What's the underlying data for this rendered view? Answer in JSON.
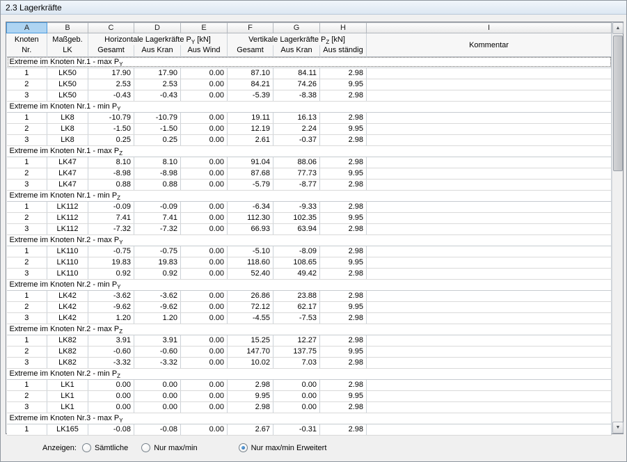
{
  "window": {
    "title": "2.3 Lagerkräfte"
  },
  "table": {
    "column_letters": [
      "A",
      "B",
      "C",
      "D",
      "E",
      "F",
      "G",
      "H",
      "I"
    ],
    "header": {
      "col_a_line1": "Knoten",
      "col_a_line2": "Nr.",
      "col_b_line1": "Maßgeb.",
      "col_b_line2": "LK",
      "py_group": {
        "prefix": "Horizontale Lagerkräfte P",
        "sub": "Y",
        "suffix": " [kN]"
      },
      "pz_group": {
        "prefix": "Vertikale Lagerkräfte P",
        "sub": "Z",
        "suffix": " [kN]"
      },
      "sub_c": "Gesamt",
      "sub_d": "Aus Kran",
      "sub_e": "Aus Wind",
      "sub_f": "Gesamt",
      "sub_g": "Aus Kran",
      "sub_h": "Aus ständig",
      "col_i": "Kommentar"
    },
    "groups": [
      {
        "prefix": "Extreme im Knoten Nr.1 - max P",
        "sub": "Y",
        "focused": true,
        "rows": [
          [
            "1",
            "LK50",
            "17.90",
            "17.90",
            "0.00",
            "87.10",
            "84.11",
            "2.98",
            ""
          ],
          [
            "2",
            "LK50",
            "2.53",
            "2.53",
            "0.00",
            "84.21",
            "74.26",
            "9.95",
            ""
          ],
          [
            "3",
            "LK50",
            "-0.43",
            "-0.43",
            "0.00",
            "-5.39",
            "-8.38",
            "2.98",
            ""
          ]
        ]
      },
      {
        "prefix": "Extreme im Knoten Nr.1 - min P",
        "sub": "Y",
        "focused": false,
        "rows": [
          [
            "1",
            "LK8",
            "-10.79",
            "-10.79",
            "0.00",
            "19.11",
            "16.13",
            "2.98",
            ""
          ],
          [
            "2",
            "LK8",
            "-1.50",
            "-1.50",
            "0.00",
            "12.19",
            "2.24",
            "9.95",
            ""
          ],
          [
            "3",
            "LK8",
            "0.25",
            "0.25",
            "0.00",
            "2.61",
            "-0.37",
            "2.98",
            ""
          ]
        ]
      },
      {
        "prefix": "Extreme im Knoten Nr.1 - max P",
        "sub": "Z",
        "focused": false,
        "rows": [
          [
            "1",
            "LK47",
            "8.10",
            "8.10",
            "0.00",
            "91.04",
            "88.06",
            "2.98",
            ""
          ],
          [
            "2",
            "LK47",
            "-8.98",
            "-8.98",
            "0.00",
            "87.68",
            "77.73",
            "9.95",
            ""
          ],
          [
            "3",
            "LK47",
            "0.88",
            "0.88",
            "0.00",
            "-5.79",
            "-8.77",
            "2.98",
            ""
          ]
        ]
      },
      {
        "prefix": "Extreme im Knoten Nr.1 - min P",
        "sub": "Z",
        "focused": false,
        "rows": [
          [
            "1",
            "LK112",
            "-0.09",
            "-0.09",
            "0.00",
            "-6.34",
            "-9.33",
            "2.98",
            ""
          ],
          [
            "2",
            "LK112",
            "7.41",
            "7.41",
            "0.00",
            "112.30",
            "102.35",
            "9.95",
            ""
          ],
          [
            "3",
            "LK112",
            "-7.32",
            "-7.32",
            "0.00",
            "66.93",
            "63.94",
            "2.98",
            ""
          ]
        ]
      },
      {
        "prefix": "Extreme im Knoten Nr.2 - max P",
        "sub": "Y",
        "focused": false,
        "rows": [
          [
            "1",
            "LK110",
            "-0.75",
            "-0.75",
            "0.00",
            "-5.10",
            "-8.09",
            "2.98",
            ""
          ],
          [
            "2",
            "LK110",
            "19.83",
            "19.83",
            "0.00",
            "118.60",
            "108.65",
            "9.95",
            ""
          ],
          [
            "3",
            "LK110",
            "0.92",
            "0.92",
            "0.00",
            "52.40",
            "49.42",
            "2.98",
            ""
          ]
        ]
      },
      {
        "prefix": "Extreme im Knoten Nr.2 - min P",
        "sub": "Y",
        "focused": false,
        "rows": [
          [
            "1",
            "LK42",
            "-3.62",
            "-3.62",
            "0.00",
            "26.86",
            "23.88",
            "2.98",
            ""
          ],
          [
            "2",
            "LK42",
            "-9.62",
            "-9.62",
            "0.00",
            "72.12",
            "62.17",
            "9.95",
            ""
          ],
          [
            "3",
            "LK42",
            "1.20",
            "1.20",
            "0.00",
            "-4.55",
            "-7.53",
            "2.98",
            ""
          ]
        ]
      },
      {
        "prefix": "Extreme im Knoten Nr.2 - max P",
        "sub": "Z",
        "focused": false,
        "rows": [
          [
            "1",
            "LK82",
            "3.91",
            "3.91",
            "0.00",
            "15.25",
            "12.27",
            "2.98",
            ""
          ],
          [
            "2",
            "LK82",
            "-0.60",
            "-0.60",
            "0.00",
            "147.70",
            "137.75",
            "9.95",
            ""
          ],
          [
            "3",
            "LK82",
            "-3.32",
            "-3.32",
            "0.00",
            "10.02",
            "7.03",
            "2.98",
            ""
          ]
        ]
      },
      {
        "prefix": "Extreme im Knoten Nr.2 - min P",
        "sub": "Z",
        "focused": false,
        "rows": [
          [
            "1",
            "LK1",
            "0.00",
            "0.00",
            "0.00",
            "2.98",
            "0.00",
            "2.98",
            ""
          ],
          [
            "2",
            "LK1",
            "0.00",
            "0.00",
            "0.00",
            "9.95",
            "0.00",
            "9.95",
            ""
          ],
          [
            "3",
            "LK1",
            "0.00",
            "0.00",
            "0.00",
            "2.98",
            "0.00",
            "2.98",
            ""
          ]
        ]
      },
      {
        "prefix": "Extreme im Knoten Nr.3 - max P",
        "sub": "Y",
        "focused": false,
        "rows": [
          [
            "1",
            "LK165",
            "-0.08",
            "-0.08",
            "0.00",
            "2.67",
            "-0.31",
            "2.98",
            ""
          ]
        ]
      }
    ]
  },
  "footer": {
    "label": "Anzeigen:",
    "options": [
      {
        "label": "Sämtliche",
        "selected": false
      },
      {
        "label": "Nur max/min",
        "selected": false
      },
      {
        "label": "Nur max/min Erweitert",
        "selected": true
      }
    ]
  },
  "colors": {
    "selected_column_bg": "#aed4f2",
    "selected_column_border": "#4a9ade",
    "radio_selected": "#1f5a9e"
  }
}
